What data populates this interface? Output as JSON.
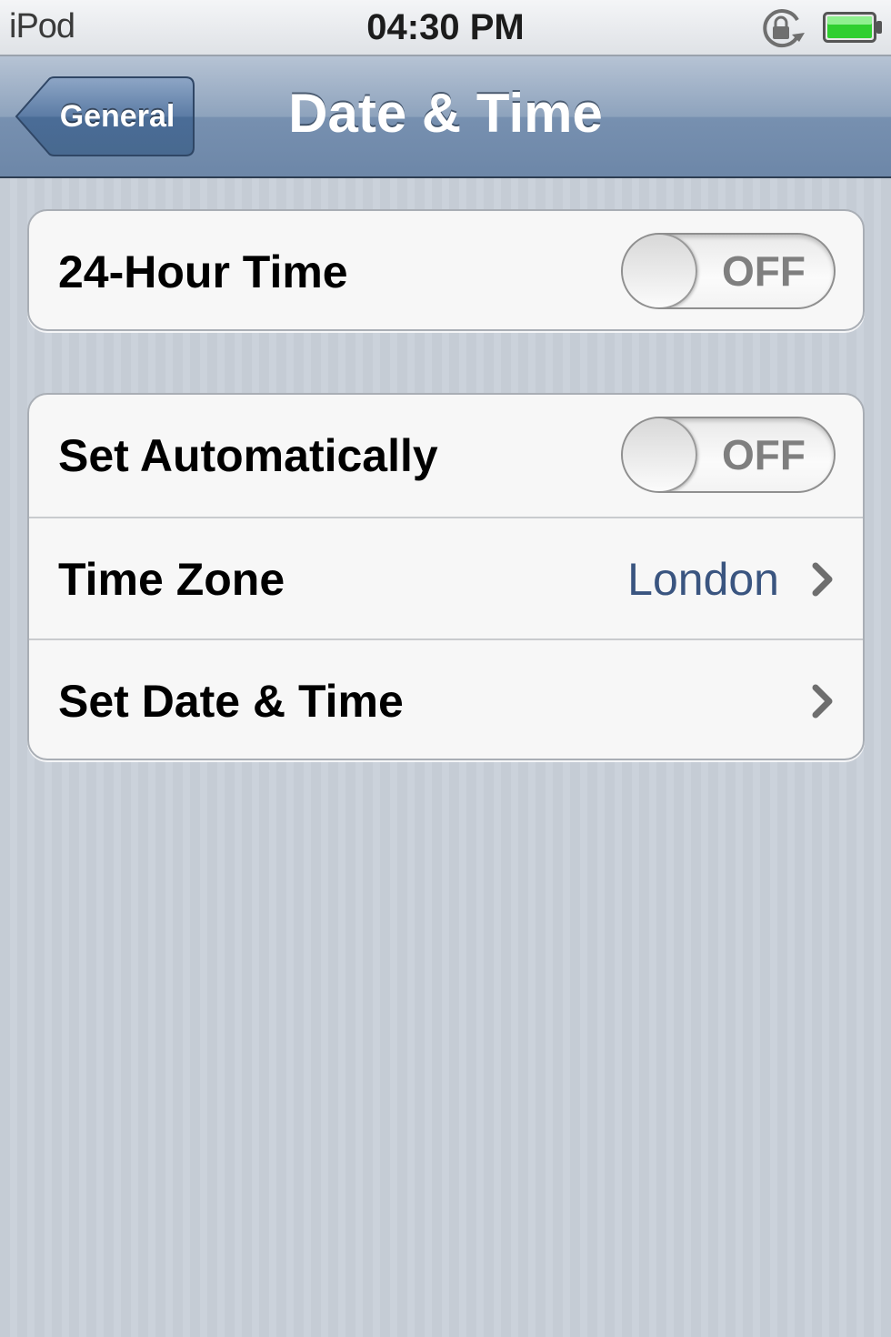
{
  "status_bar": {
    "carrier": "iPod",
    "time": "04:30 PM",
    "battery_color": "#2fcf2f"
  },
  "nav": {
    "back_label": "General",
    "title": "Date & Time"
  },
  "settings": {
    "hour24": {
      "label": "24-Hour Time",
      "toggle": "OFF"
    },
    "set_automatically": {
      "label": "Set Automatically",
      "toggle": "OFF"
    },
    "time_zone": {
      "label": "Time Zone",
      "value": "London"
    },
    "set_date_time": {
      "label": "Set Date & Time"
    }
  },
  "colors": {
    "nav_bar": "#7790b0",
    "background": "#c5ccd5",
    "detail_text": "#3a5580"
  }
}
